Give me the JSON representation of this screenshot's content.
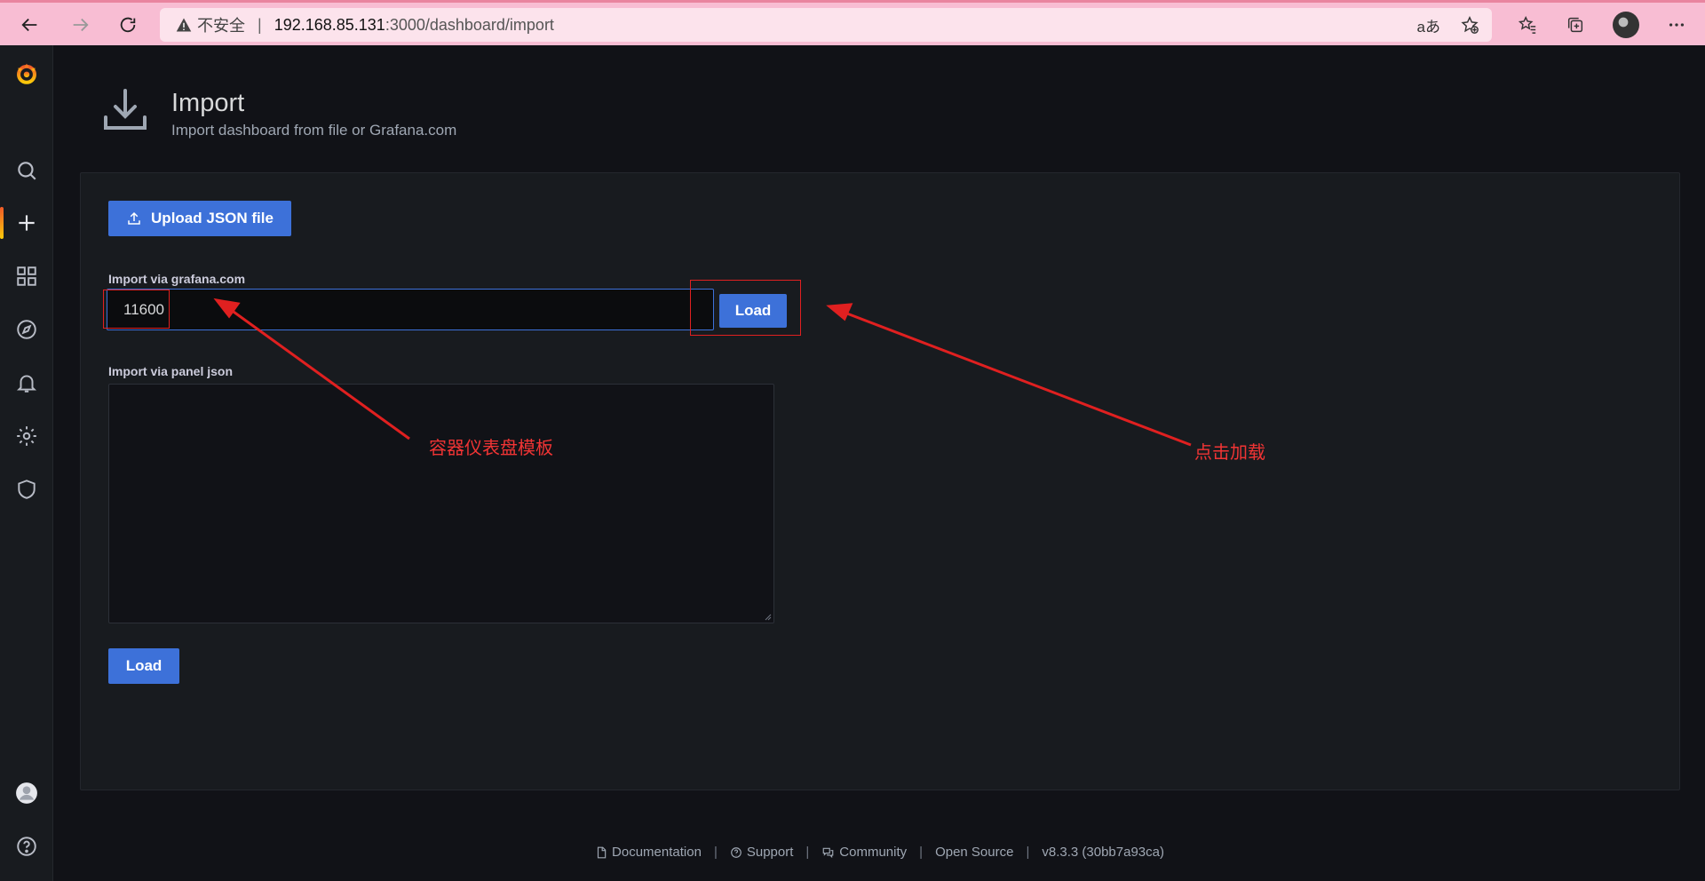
{
  "browser": {
    "security_label": "不安全",
    "url_host": "192.168.85.131",
    "url_path": ":3000/dashboard/import",
    "translate_label": "aあ"
  },
  "page": {
    "title": "Import",
    "subtitle": "Import dashboard from file or Grafana.com"
  },
  "form": {
    "upload_label": "Upload JSON file",
    "grafana_com_label": "Import via grafana.com",
    "grafana_com_value": "11600",
    "load_label": "Load",
    "panel_json_label": "Import via panel json",
    "panel_json_value": "",
    "load_bottom_label": "Load"
  },
  "annotations": {
    "template_note": "容器仪表盘模板",
    "click_note": "点击加载"
  },
  "footer": {
    "documentation": "Documentation",
    "support": "Support",
    "community": "Community",
    "open_source": "Open Source",
    "version": "v8.3.3 (30bb7a93ca)"
  },
  "colors": {
    "accent": "#3d71d9",
    "annotation": "#e02020"
  }
}
